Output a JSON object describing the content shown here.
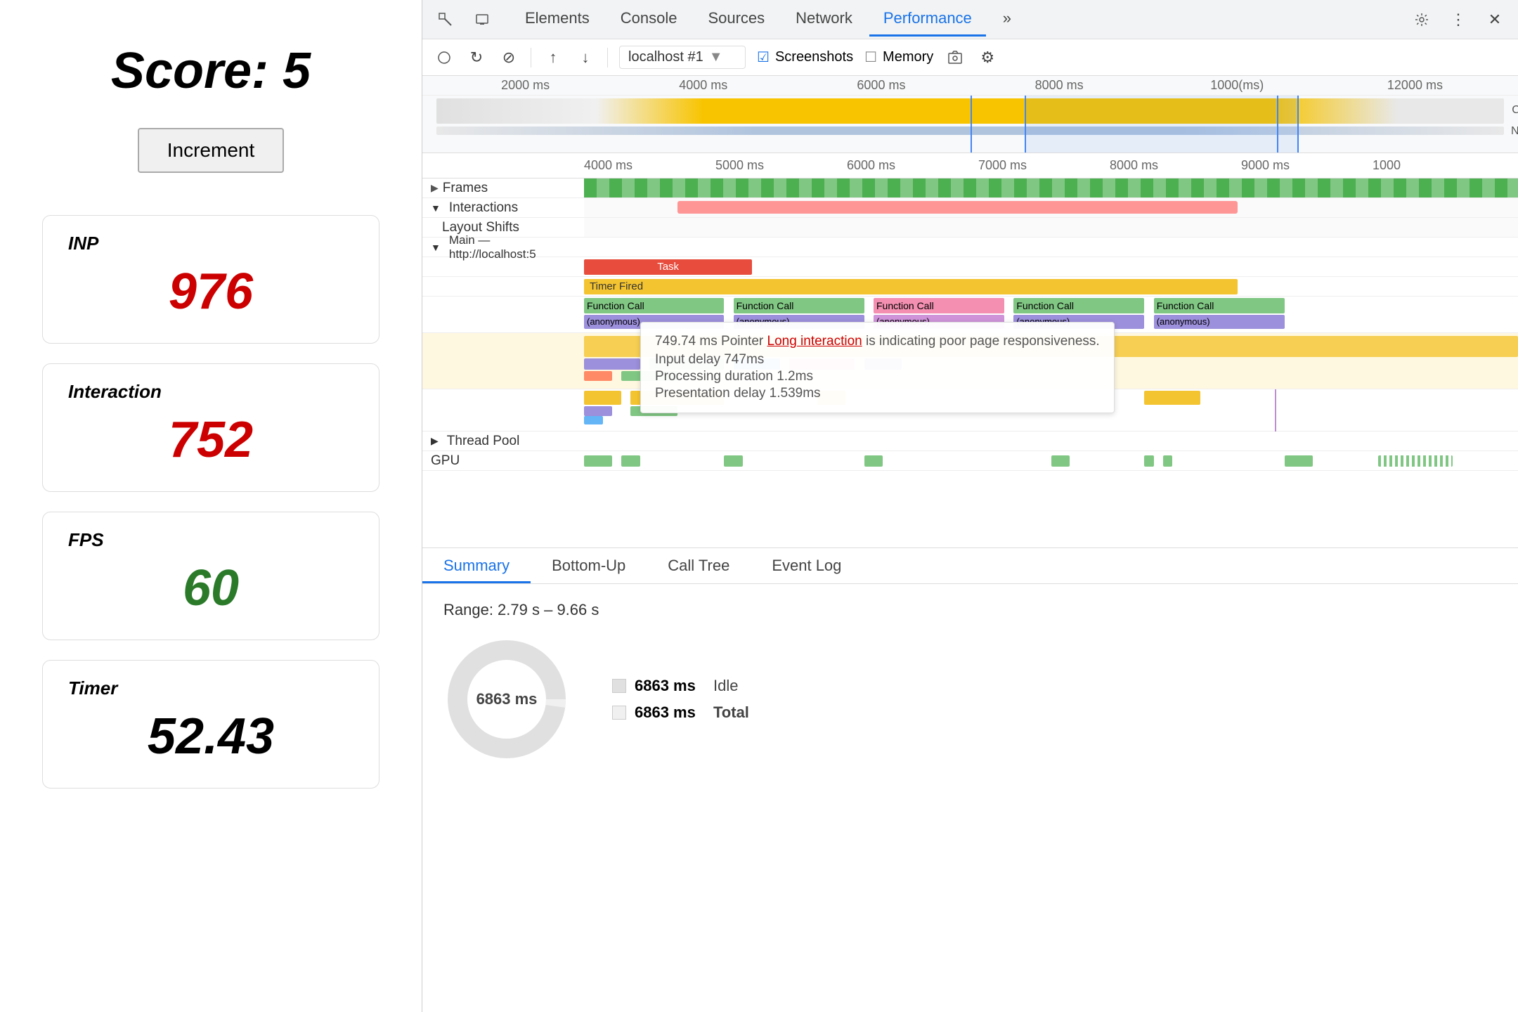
{
  "left": {
    "score_label": "Score:  5",
    "increment_btn": "Increment",
    "metrics": [
      {
        "id": "inp",
        "label": "INP",
        "value": "976",
        "color": "red"
      },
      {
        "id": "interaction",
        "label": "Interaction",
        "value": "752",
        "color": "red"
      },
      {
        "id": "fps",
        "label": "FPS",
        "value": "60",
        "color": "green"
      },
      {
        "id": "timer",
        "label": "Timer",
        "value": "52.43",
        "color": "black"
      }
    ]
  },
  "devtools": {
    "tabs": [
      "Elements",
      "Console",
      "Sources",
      "Network",
      "Performance"
    ],
    "active_tab": "Performance",
    "toolbar": {
      "url": "localhost #1",
      "screenshots_label": "Screenshots",
      "memory_label": "Memory"
    },
    "overview_ticks": [
      "2000 ms",
      "4000 ms",
      "6000 ms",
      "8000 ms",
      "1000(ms)",
      "12000 ms"
    ],
    "timeline_ticks": [
      "4000 ms",
      "5000 ms",
      "6000 ms",
      "7000 ms",
      "8000 ms",
      "9000 ms",
      "1000"
    ],
    "tracks": {
      "frames": "Frames",
      "interactions": "Interactions",
      "layout_shifts": "Layout Shifts",
      "main": "Main — http://localhost:5",
      "thread_pool": "Thread Pool",
      "gpu": "GPU"
    },
    "tooltip": {
      "time": "749.74 ms",
      "type": "Pointer",
      "link_text": "Long interaction",
      "message": "is indicating poor page responsiveness.",
      "input_delay": "Input delay  747ms",
      "processing_duration": "Processing duration  1.2ms",
      "presentation_delay": "Presentation delay  1.539ms"
    },
    "task_bars": [
      {
        "label": "Task",
        "color": "red"
      },
      {
        "label": "Timer Fired",
        "color": "yellow"
      }
    ],
    "fn_calls": [
      {
        "label": "Function Call",
        "sub": "(anonymous)"
      },
      {
        "label": "Function Call",
        "sub": "(anonymous)"
      },
      {
        "label": "Function Call",
        "sub": "(anonymous)"
      },
      {
        "label": "Function Call",
        "sub": "(anonymous)"
      },
      {
        "label": "Function Call",
        "sub": "(anonymous)"
      }
    ],
    "bottom_tabs": [
      "Summary",
      "Bottom-Up",
      "Call Tree",
      "Event Log"
    ],
    "active_bottom_tab": "Summary",
    "summary": {
      "range": "Range: 2.79 s – 9.66 s",
      "donut_label": "6863 ms",
      "legend": [
        {
          "value": "6863 ms",
          "name": "Idle",
          "color": "#e0e0e0"
        },
        {
          "value": "6863 ms",
          "name": "Total",
          "color": "#f0f0f0"
        }
      ]
    }
  }
}
